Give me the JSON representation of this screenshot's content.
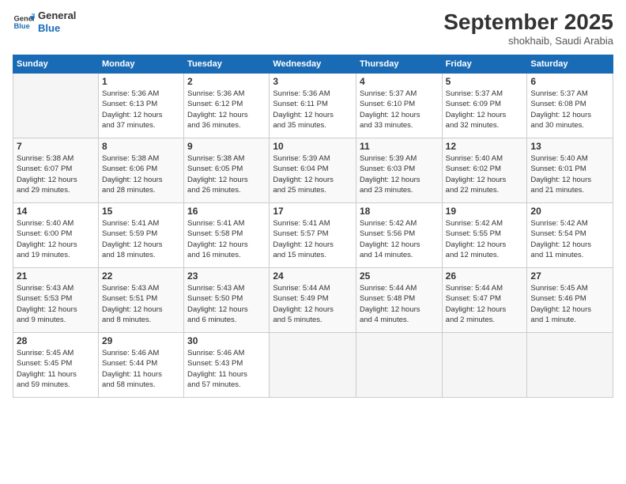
{
  "logo": {
    "text_general": "General",
    "text_blue": "Blue"
  },
  "header": {
    "month": "September 2025",
    "location": "shokhaib, Saudi Arabia"
  },
  "weekdays": [
    "Sunday",
    "Monday",
    "Tuesday",
    "Wednesday",
    "Thursday",
    "Friday",
    "Saturday"
  ],
  "weeks": [
    [
      {
        "day": "",
        "info": ""
      },
      {
        "day": "1",
        "info": "Sunrise: 5:36 AM\nSunset: 6:13 PM\nDaylight: 12 hours\nand 37 minutes."
      },
      {
        "day": "2",
        "info": "Sunrise: 5:36 AM\nSunset: 6:12 PM\nDaylight: 12 hours\nand 36 minutes."
      },
      {
        "day": "3",
        "info": "Sunrise: 5:36 AM\nSunset: 6:11 PM\nDaylight: 12 hours\nand 35 minutes."
      },
      {
        "day": "4",
        "info": "Sunrise: 5:37 AM\nSunset: 6:10 PM\nDaylight: 12 hours\nand 33 minutes."
      },
      {
        "day": "5",
        "info": "Sunrise: 5:37 AM\nSunset: 6:09 PM\nDaylight: 12 hours\nand 32 minutes."
      },
      {
        "day": "6",
        "info": "Sunrise: 5:37 AM\nSunset: 6:08 PM\nDaylight: 12 hours\nand 30 minutes."
      }
    ],
    [
      {
        "day": "7",
        "info": "Sunrise: 5:38 AM\nSunset: 6:07 PM\nDaylight: 12 hours\nand 29 minutes."
      },
      {
        "day": "8",
        "info": "Sunrise: 5:38 AM\nSunset: 6:06 PM\nDaylight: 12 hours\nand 28 minutes."
      },
      {
        "day": "9",
        "info": "Sunrise: 5:38 AM\nSunset: 6:05 PM\nDaylight: 12 hours\nand 26 minutes."
      },
      {
        "day": "10",
        "info": "Sunrise: 5:39 AM\nSunset: 6:04 PM\nDaylight: 12 hours\nand 25 minutes."
      },
      {
        "day": "11",
        "info": "Sunrise: 5:39 AM\nSunset: 6:03 PM\nDaylight: 12 hours\nand 23 minutes."
      },
      {
        "day": "12",
        "info": "Sunrise: 5:40 AM\nSunset: 6:02 PM\nDaylight: 12 hours\nand 22 minutes."
      },
      {
        "day": "13",
        "info": "Sunrise: 5:40 AM\nSunset: 6:01 PM\nDaylight: 12 hours\nand 21 minutes."
      }
    ],
    [
      {
        "day": "14",
        "info": "Sunrise: 5:40 AM\nSunset: 6:00 PM\nDaylight: 12 hours\nand 19 minutes."
      },
      {
        "day": "15",
        "info": "Sunrise: 5:41 AM\nSunset: 5:59 PM\nDaylight: 12 hours\nand 18 minutes."
      },
      {
        "day": "16",
        "info": "Sunrise: 5:41 AM\nSunset: 5:58 PM\nDaylight: 12 hours\nand 16 minutes."
      },
      {
        "day": "17",
        "info": "Sunrise: 5:41 AM\nSunset: 5:57 PM\nDaylight: 12 hours\nand 15 minutes."
      },
      {
        "day": "18",
        "info": "Sunrise: 5:42 AM\nSunset: 5:56 PM\nDaylight: 12 hours\nand 14 minutes."
      },
      {
        "day": "19",
        "info": "Sunrise: 5:42 AM\nSunset: 5:55 PM\nDaylight: 12 hours\nand 12 minutes."
      },
      {
        "day": "20",
        "info": "Sunrise: 5:42 AM\nSunset: 5:54 PM\nDaylight: 12 hours\nand 11 minutes."
      }
    ],
    [
      {
        "day": "21",
        "info": "Sunrise: 5:43 AM\nSunset: 5:53 PM\nDaylight: 12 hours\nand 9 minutes."
      },
      {
        "day": "22",
        "info": "Sunrise: 5:43 AM\nSunset: 5:51 PM\nDaylight: 12 hours\nand 8 minutes."
      },
      {
        "day": "23",
        "info": "Sunrise: 5:43 AM\nSunset: 5:50 PM\nDaylight: 12 hours\nand 6 minutes."
      },
      {
        "day": "24",
        "info": "Sunrise: 5:44 AM\nSunset: 5:49 PM\nDaylight: 12 hours\nand 5 minutes."
      },
      {
        "day": "25",
        "info": "Sunrise: 5:44 AM\nSunset: 5:48 PM\nDaylight: 12 hours\nand 4 minutes."
      },
      {
        "day": "26",
        "info": "Sunrise: 5:44 AM\nSunset: 5:47 PM\nDaylight: 12 hours\nand 2 minutes."
      },
      {
        "day": "27",
        "info": "Sunrise: 5:45 AM\nSunset: 5:46 PM\nDaylight: 12 hours\nand 1 minute."
      }
    ],
    [
      {
        "day": "28",
        "info": "Sunrise: 5:45 AM\nSunset: 5:45 PM\nDaylight: 11 hours\nand 59 minutes."
      },
      {
        "day": "29",
        "info": "Sunrise: 5:46 AM\nSunset: 5:44 PM\nDaylight: 11 hours\nand 58 minutes."
      },
      {
        "day": "30",
        "info": "Sunrise: 5:46 AM\nSunset: 5:43 PM\nDaylight: 11 hours\nand 57 minutes."
      },
      {
        "day": "",
        "info": ""
      },
      {
        "day": "",
        "info": ""
      },
      {
        "day": "",
        "info": ""
      },
      {
        "day": "",
        "info": ""
      }
    ]
  ]
}
